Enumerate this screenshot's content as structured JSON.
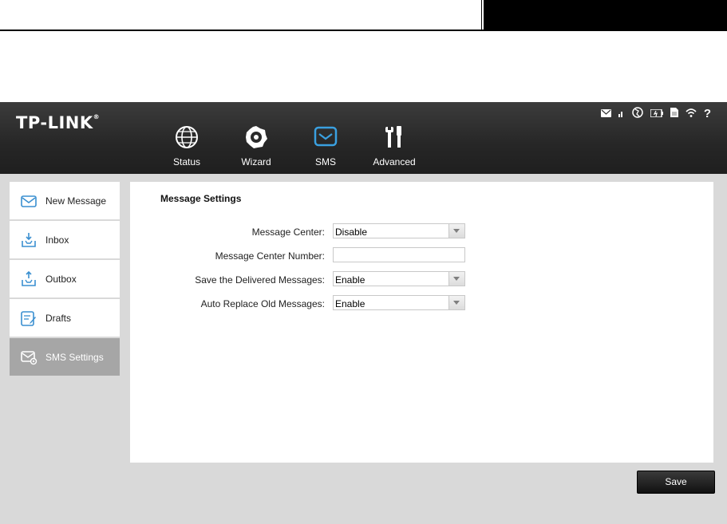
{
  "brand": {
    "logo_text": "TP-LINK",
    "logo_mark": "®"
  },
  "nav": {
    "items": [
      {
        "label": "Status",
        "icon": "globe-icon"
      },
      {
        "label": "Wizard",
        "icon": "gear-icon"
      },
      {
        "label": "SMS",
        "icon": "envelope-icon",
        "active": true
      },
      {
        "label": "Advanced",
        "icon": "tools-icon"
      }
    ]
  },
  "status_bar": {
    "icons": [
      "message-icon",
      "signal-icon",
      "internet-icon",
      "battery-icon",
      "sim-card-icon",
      "wifi-icon",
      "help-icon"
    ],
    "help_glyph": "?"
  },
  "sidebar": {
    "items": [
      {
        "label": "New Message",
        "icon": "new-message-icon"
      },
      {
        "label": "Inbox",
        "icon": "inbox-icon"
      },
      {
        "label": "Outbox",
        "icon": "outbox-icon"
      },
      {
        "label": "Drafts",
        "icon": "drafts-icon"
      },
      {
        "label": "SMS Settings",
        "icon": "sms-settings-icon",
        "active": true
      }
    ]
  },
  "settings": {
    "title": "Message Settings",
    "fields": [
      {
        "label": "Message Center:",
        "type": "select",
        "value": "Disable"
      },
      {
        "label": "Message Center Number:",
        "type": "text",
        "value": ""
      },
      {
        "label": "Save the Delivered Messages:",
        "type": "select",
        "value": "Enable"
      },
      {
        "label": "Auto Replace Old Messages:",
        "type": "select",
        "value": "Enable"
      }
    ]
  },
  "actions": {
    "save_label": "Save"
  },
  "colors": {
    "topbar": "#262626",
    "active_nav": "#3aa0e0",
    "sidebar_active": "#a6a6a6",
    "page_bg": "#d9d9d9"
  }
}
